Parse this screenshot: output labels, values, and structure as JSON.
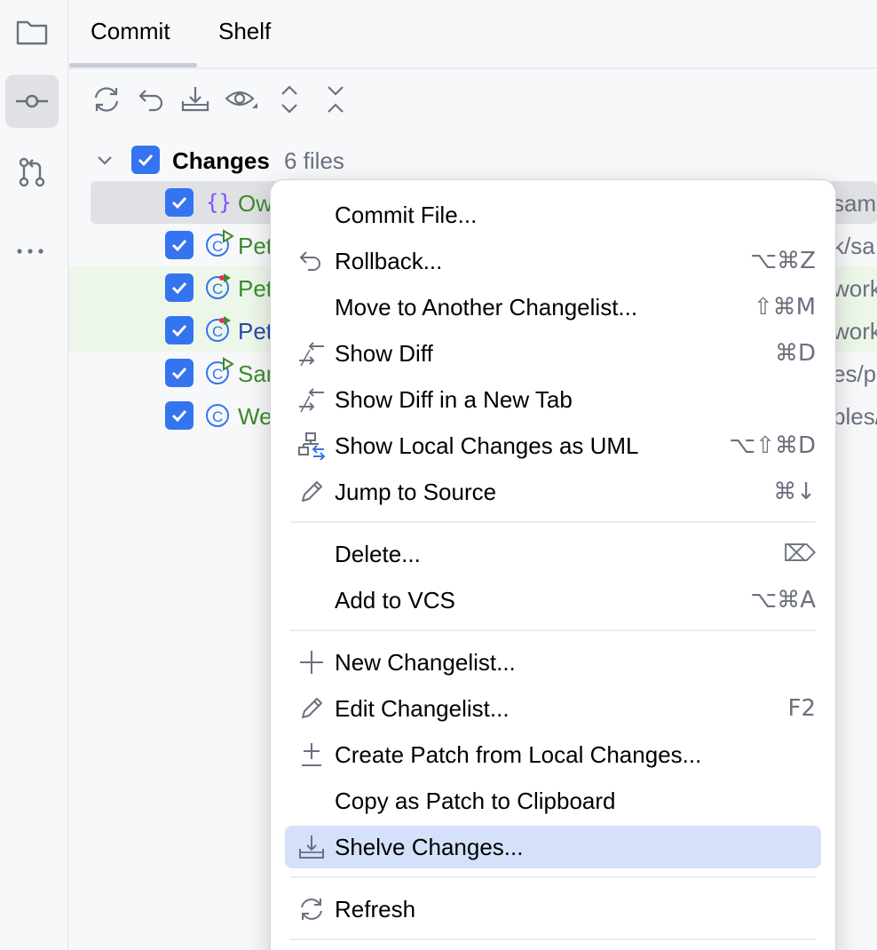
{
  "tabs": [
    {
      "label": "Commit",
      "active": true
    },
    {
      "label": "Shelf",
      "active": false
    }
  ],
  "toolstrip": [
    "folder-icon",
    "commit-icon",
    "pull-requests-icon",
    "more-icon"
  ],
  "toolbar": [
    "refresh-icon",
    "rollback-icon",
    "shelve-icon",
    "view-options-icon",
    "expand-all-icon",
    "collapse-all-icon"
  ],
  "changes": {
    "label": "Changes",
    "count": "6 files",
    "files": [
      {
        "name": "Ow",
        "icon": "json-icon",
        "color": "#3d8a2e",
        "path": "samp"
      },
      {
        "name": "Pet",
        "icon": "class-runnable-icon",
        "color": "#3d8a2e",
        "path": "k/sa"
      },
      {
        "name": "Pet",
        "icon": "class-conflict-icon",
        "color": "#3d8a2e",
        "path": "work"
      },
      {
        "name": "Pet",
        "icon": "class-conflict-icon",
        "color": "#2a48a8",
        "path": "work"
      },
      {
        "name": "Sar",
        "icon": "class-runnable-icon",
        "color": "#3d8a2e",
        "path": "es/p"
      },
      {
        "name": "We",
        "icon": "class-icon",
        "color": "#3d8a2e",
        "path": "bles/"
      }
    ]
  },
  "menu": {
    "items": [
      {
        "label": "Commit File...",
        "shortcut": "",
        "icon": ""
      },
      {
        "label": "Rollback...",
        "shortcut": "⌥⌘Z",
        "icon": "rollback-icon"
      },
      {
        "label": "Move to Another Changelist...",
        "shortcut": "⇧⌘M",
        "icon": ""
      },
      {
        "label": "Show Diff",
        "shortcut": "⌘D",
        "icon": "diff-icon"
      },
      {
        "label": "Show Diff in a New Tab",
        "shortcut": "",
        "icon": "diff-icon"
      },
      {
        "label": "Show Local Changes as UML",
        "shortcut": "⌥⇧⌘D",
        "icon": "uml-icon"
      },
      {
        "label": "Jump to Source",
        "shortcut": "⌘↓",
        "icon": "edit-icon"
      },
      {
        "label": "Delete...",
        "shortcut": "⌦",
        "icon": ""
      },
      {
        "label": "Add to VCS",
        "shortcut": "⌥⌘A",
        "icon": ""
      },
      {
        "label": "New Changelist...",
        "shortcut": "",
        "icon": "add-icon"
      },
      {
        "label": "Edit Changelist...",
        "shortcut": "F2",
        "icon": "edit-icon"
      },
      {
        "label": "Create Patch from Local Changes...",
        "shortcut": "",
        "icon": "patch-icon"
      },
      {
        "label": "Copy as Patch to Clipboard",
        "shortcut": "",
        "icon": ""
      },
      {
        "label": "Shelve Changes...",
        "shortcut": "",
        "icon": "shelve-icon",
        "highlighted": true
      },
      {
        "label": "Refresh",
        "shortcut": "",
        "icon": "refresh-icon"
      }
    ]
  },
  "colors": {
    "accent": "#3574f0",
    "highlight": "#d5e1fb",
    "added_text": "#3d8a2e",
    "modified_text": "#2a48a8"
  }
}
